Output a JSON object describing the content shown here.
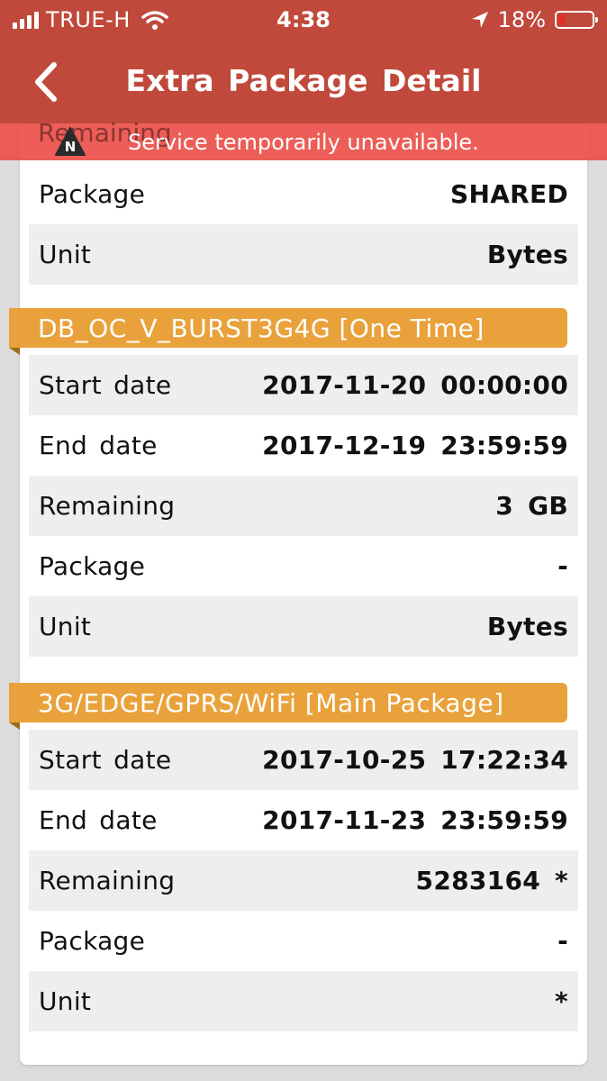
{
  "status": {
    "carrier": "TRUE-H",
    "time": "4:38",
    "battery": "18%",
    "battery_level": 0.18
  },
  "nav": {
    "title": "Extra Package Detail",
    "back_icon": "chevron-left-icon"
  },
  "banner": {
    "message": "Service temporarily unavailable.",
    "icon_letter": "N",
    "ghost_text": "Remaining"
  },
  "top_section": {
    "rows": [
      {
        "label": "Package",
        "value": "SHARED"
      },
      {
        "label": "Unit",
        "value": "Bytes"
      }
    ]
  },
  "sections": [
    {
      "title": "DB_OC_V_BURST3G4G [One Time]",
      "rows": [
        {
          "label": "Start date",
          "value": "2017-11-20 00:00:00"
        },
        {
          "label": "End date",
          "value": "2017-12-19 23:59:59"
        },
        {
          "label": "Remaining",
          "value": "3 GB"
        },
        {
          "label": "Package",
          "value": "-"
        },
        {
          "label": "Unit",
          "value": "Bytes"
        }
      ]
    },
    {
      "title": "3G/EDGE/GPRS/WiFi [Main Package]",
      "rows": [
        {
          "label": "Start date",
          "value": "2017-10-25 17:22:34"
        },
        {
          "label": "End date",
          "value": "2017-11-23 23:59:59"
        },
        {
          "label": "Remaining",
          "value": "5283164 *"
        },
        {
          "label": "Package",
          "value": "-"
        },
        {
          "label": "Unit",
          "value": "*"
        }
      ]
    }
  ],
  "colors": {
    "nav_bg": "#c0493b",
    "banner_bg": "#eb524a",
    "section_header": "#e9a23b",
    "row_shade": "#eeeeee"
  }
}
